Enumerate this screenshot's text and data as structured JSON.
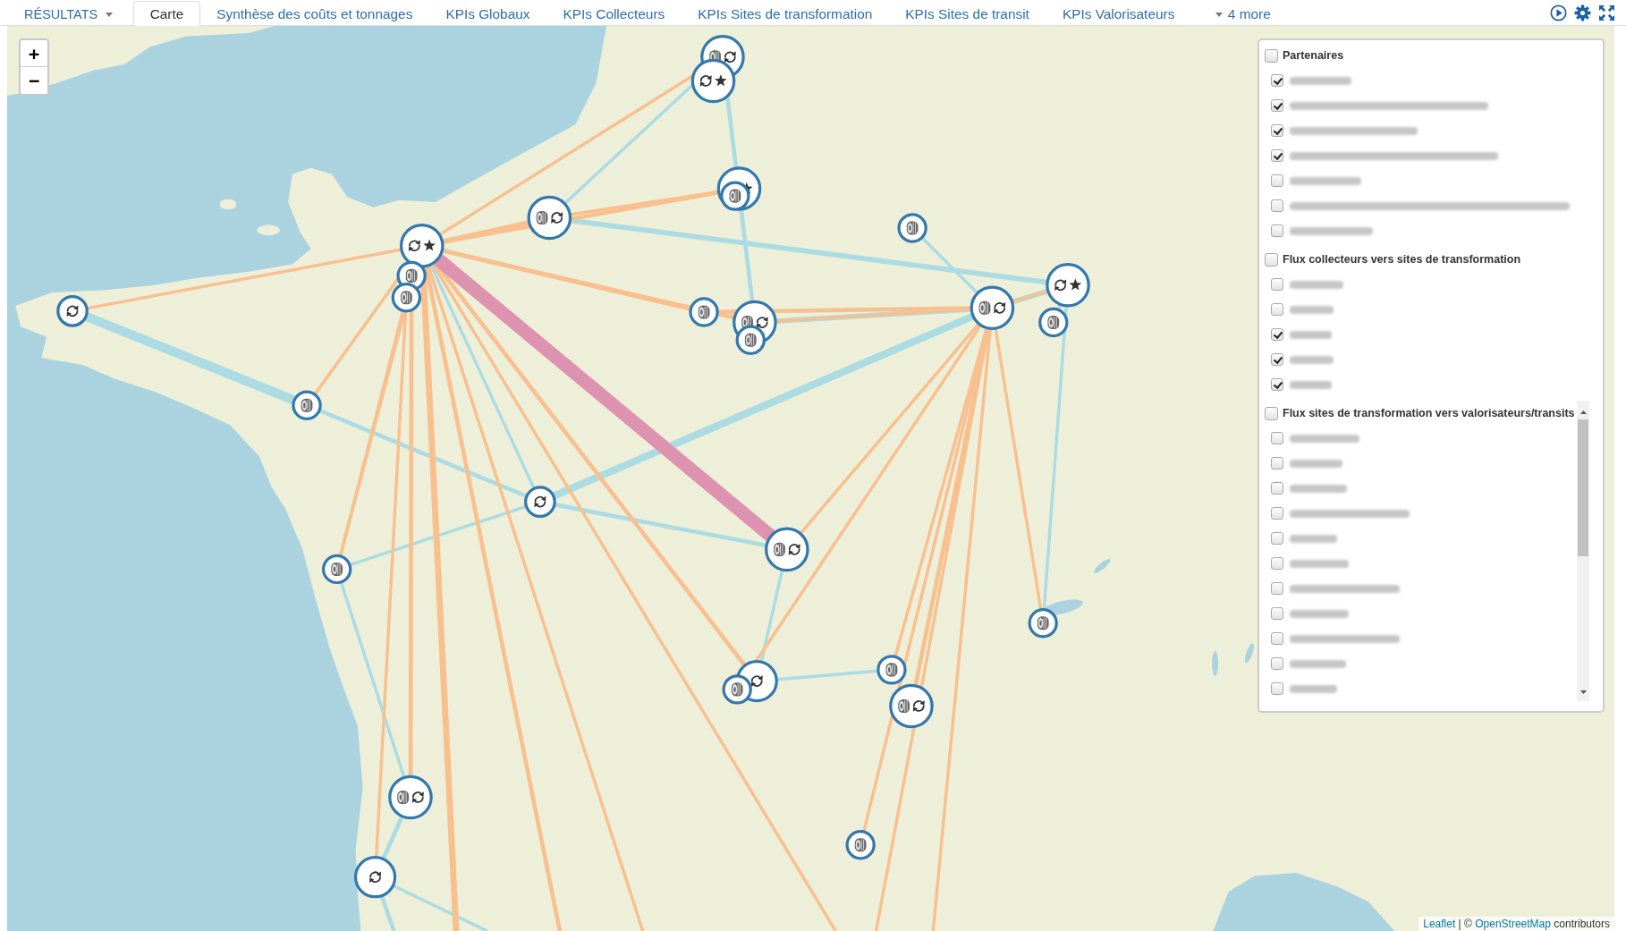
{
  "tab_bar": {
    "menu": {
      "label": "RÉSULTATS"
    },
    "tabs": [
      {
        "label": "Carte",
        "selected": true
      },
      {
        "label": "Synthèse des coûts et tonnages",
        "selected": false
      },
      {
        "label": "KPIs Globaux",
        "selected": false
      },
      {
        "label": "KPIs Collecteurs",
        "selected": false
      },
      {
        "label": "KPIs Sites de transformation",
        "selected": false
      },
      {
        "label": "KPIs Sites de transit",
        "selected": false
      },
      {
        "label": "KPIs Valorisateurs",
        "selected": false
      }
    ],
    "more": {
      "label": "4 more"
    }
  },
  "map": {
    "zoom_control": {
      "zoom_in": "+",
      "zoom_out": "−"
    },
    "flows": [
      {
        "kind": "valorisation"
      },
      {
        "kind": "valorisation"
      },
      {
        "kind": "valorisation"
      },
      {
        "kind": "valorisation"
      },
      {
        "kind": "valorisation"
      },
      {
        "kind": "valorisation"
      },
      {
        "kind": "valorisation"
      },
      {
        "kind": "valorisation"
      },
      {
        "kind": "valorisation"
      },
      {
        "kind": "valorisation"
      },
      {
        "kind": "valorisation"
      },
      {
        "kind": "valorisation"
      },
      {
        "kind": "valorisation"
      },
      {
        "kind": "valorisation"
      },
      {
        "kind": "valorisation"
      },
      {
        "kind": "valorisation"
      },
      {
        "kind": "valorisation"
      },
      {
        "kind": "valorisation"
      },
      {
        "kind": "valorisation"
      },
      {
        "kind": "valorisation"
      },
      {
        "kind": "valorisation"
      },
      {
        "kind": "collection"
      },
      {
        "kind": "collection"
      },
      {
        "kind": "collection"
      },
      {
        "kind": "collection"
      },
      {
        "kind": "collection"
      },
      {
        "kind": "collection"
      },
      {
        "kind": "collection"
      },
      {
        "kind": "collection"
      },
      {
        "kind": "collection"
      },
      {
        "kind": "collection"
      },
      {
        "kind": "collection"
      },
      {
        "kind": "collection"
      },
      {
        "kind": "collection"
      },
      {
        "kind": "collection"
      },
      {
        "kind": "collection"
      },
      {
        "kind": "collection"
      },
      {
        "kind": "collection"
      },
      {
        "kind": "collection"
      },
      {
        "kind": "collection"
      },
      {
        "kind": "collection"
      },
      {
        "kind": "collection"
      },
      {
        "kind": "collection"
      },
      {
        "kind": "collection"
      },
      {
        "kind": "collection"
      },
      {
        "kind": "collection"
      },
      {
        "kind": "collection"
      },
      {
        "kind": "collection"
      },
      {
        "kind": "collection"
      },
      {
        "kind": "highlight"
      }
    ],
    "markers": [
      {
        "kind": "tire_refresh"
      },
      {
        "kind": "refresh_star"
      },
      {
        "kind": "tire_star"
      },
      {
        "kind": "tire"
      },
      {
        "kind": "tire_refresh"
      },
      {
        "kind": "tire"
      },
      {
        "kind": "refresh_star"
      },
      {
        "kind": "tire"
      },
      {
        "kind": "refresh_star"
      },
      {
        "kind": "tire"
      },
      {
        "kind": "tire_refresh"
      },
      {
        "kind": "refresh"
      },
      {
        "kind": "tire"
      },
      {
        "kind": "tire"
      },
      {
        "kind": "tire_refresh"
      },
      {
        "kind": "tire"
      },
      {
        "kind": "tire"
      },
      {
        "kind": "refresh"
      },
      {
        "kind": "tire_refresh"
      },
      {
        "kind": "tire"
      },
      {
        "kind": "tire"
      },
      {
        "kind": "tire"
      },
      {
        "kind": "refresh"
      },
      {
        "kind": "tire"
      },
      {
        "kind": "tire_refresh"
      },
      {
        "kind": "tire_refresh"
      },
      {
        "kind": "tire"
      },
      {
        "kind": "refresh"
      }
    ],
    "layer_control": {
      "sections": [
        {
          "title": "Partenaires",
          "checked": false,
          "items": [
            {
              "checked": true
            },
            {
              "checked": true
            },
            {
              "checked": true
            },
            {
              "checked": true
            },
            {
              "checked": false
            },
            {
              "checked": false
            },
            {
              "checked": false
            }
          ]
        },
        {
          "title": "Flux collecteurs vers sites de transformation",
          "checked": false,
          "items": [
            {
              "checked": false
            },
            {
              "checked": false
            },
            {
              "checked": true
            },
            {
              "checked": true
            },
            {
              "checked": true
            }
          ]
        },
        {
          "title": "Flux sites de transformation vers valorisateurs/transits",
          "checked": false,
          "scrollable": true,
          "items": [
            {
              "checked": false
            },
            {
              "checked": false
            },
            {
              "checked": false
            },
            {
              "checked": false
            },
            {
              "checked": false
            },
            {
              "checked": false
            },
            {
              "checked": false
            },
            {
              "checked": false
            },
            {
              "checked": false
            },
            {
              "checked": false
            },
            {
              "checked": false
            }
          ]
        }
      ]
    },
    "attribution": [
      {
        "kind": "link",
        "text": "Leaflet"
      },
      {
        "kind": "text",
        "text": " | © "
      },
      {
        "kind": "link",
        "text": "OpenStreetMap"
      },
      {
        "kind": "text",
        "text": " contributors"
      }
    ]
  }
}
